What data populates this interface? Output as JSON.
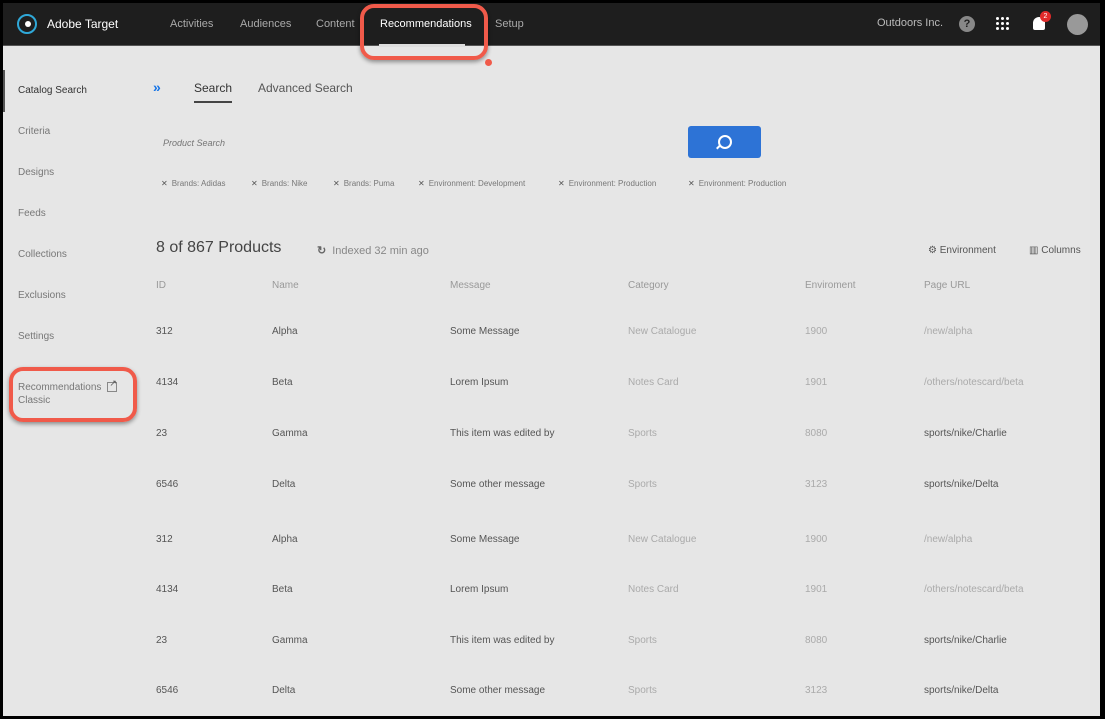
{
  "header": {
    "brand": "Adobe Target",
    "nav": [
      "Activities",
      "Audiences",
      "Content",
      "Recommendations",
      "Setup"
    ],
    "active_nav": "Recommendations",
    "org": "Outdoors Inc.",
    "help": "?",
    "notifications": "2"
  },
  "sidebar": {
    "items": [
      "Catalog Search",
      "Criteria",
      "Designs",
      "Feeds",
      "Collections",
      "Exclusions",
      "Settings"
    ],
    "classic_line1": "Recommendations",
    "classic_line2": "Classic"
  },
  "tabs": {
    "expand": "»",
    "search": "Search",
    "advanced": "Advanced Search"
  },
  "search": {
    "placeholder": "Product Search"
  },
  "filters": [
    "Brands: Adidas",
    "Brands: Nike",
    "Brands: Puma",
    "Environment: Development",
    "Environment: Production",
    "Environment: Production"
  ],
  "results": {
    "count": "8 of 867 Products",
    "indexed": "Indexed 32 min ago",
    "environment": "Environment",
    "columns": "Columns"
  },
  "table": {
    "headers": [
      "ID",
      "Name",
      "Message",
      "Category",
      "Enviroment",
      "Page URL"
    ],
    "rows": [
      [
        "312",
        "Alpha",
        "Some Message",
        "New Catalogue",
        "1900",
        "/new/alpha"
      ],
      [
        "4134",
        "Beta",
        "Lorem Ipsum",
        "Notes Card",
        "1901",
        "/others/notescard/beta"
      ],
      [
        "23",
        "Gamma",
        "This item was edited by",
        "Sports",
        "8080",
        "sports/nike/Charlie"
      ],
      [
        "6546",
        "Delta",
        "Some other message",
        "Sports",
        "3123",
        "sports/nike/Delta"
      ],
      [
        "312",
        "Alpha",
        "Some Message",
        "New Catalogue",
        "1900",
        "/new/alpha"
      ],
      [
        "4134",
        "Beta",
        "Lorem Ipsum",
        "Notes Card",
        "1901",
        "/others/notescard/beta"
      ],
      [
        "23",
        "Gamma",
        "This item was edited by",
        "Sports",
        "8080",
        "sports/nike/Charlie"
      ],
      [
        "6546",
        "Delta",
        "Some other message",
        "Sports",
        "3123",
        "sports/nike/Delta"
      ]
    ]
  },
  "colors": {
    "accent": "#2d73d6",
    "annotation": "#f05a4a",
    "topbar": "#1e1e1e"
  }
}
